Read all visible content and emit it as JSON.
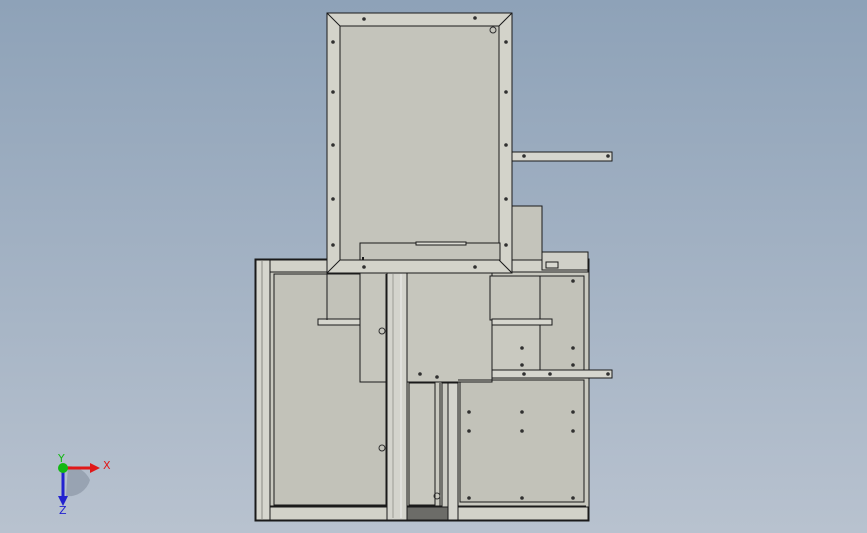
{
  "view": {
    "background_top": "#8ea2b8",
    "background_bottom": "#b8c2cf"
  },
  "model": {
    "face_color": "#c4c4bb",
    "face_dark": "#b7b7ad",
    "face_light": "#d4d4cb",
    "edge_color": "#1a1a1a",
    "shaft_color": "#cfcfc8"
  },
  "triad": {
    "x_label": "X",
    "y_label": "Y",
    "z_label": "Z",
    "x_color": "#e01818",
    "y_color": "#12b812",
    "z_color": "#2222d0"
  }
}
